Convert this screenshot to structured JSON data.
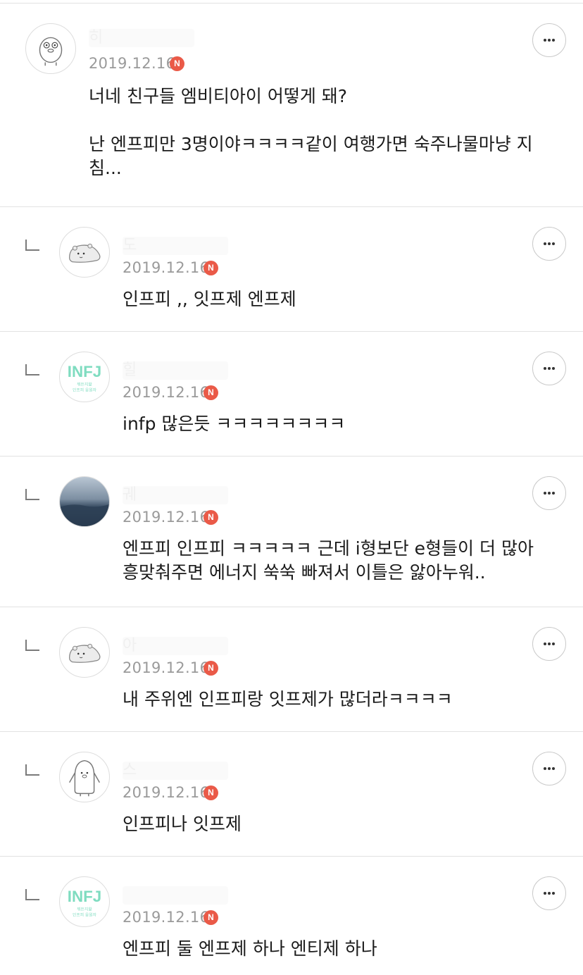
{
  "comments": [
    {
      "nickname": "히",
      "date": "2019.12.16",
      "badge": "N",
      "avatar": "duck",
      "text": "너네 친구들 엠비티아이 어떻게 돼?\n\n난 엔프피만 3명이야ㅋㅋㅋㅋ같이 여행가면 숙주나물마냥 지\n침...",
      "is_reply": false
    },
    {
      "nickname": "도",
      "date": "2019.12.16",
      "badge": "N",
      "avatar": "seal",
      "text": "인프피 ,, 잇프제 엔프제",
      "is_reply": true
    },
    {
      "nickname": "힐",
      "date": "2019.12.16",
      "badge": "N",
      "avatar": "infj",
      "avatar_text": "INFJ",
      "avatar_sub1": "뭐든지할",
      "avatar_sub2": "인프피 응원자",
      "text": "infp 많은듯 ㅋㅋㅋㅋㅋㅋㅋㅋ",
      "is_reply": true
    },
    {
      "nickname": "궤",
      "date": "2019.12.16",
      "badge": "N",
      "avatar": "sky",
      "text": "엔프피 인프피 ㅋㅋㅋㅋㅋ 근데 i형보단 e형들이 더 많아\n흥맞춰주면 에너지 쑥쑥 빠져서 이틀은 앓아누워..",
      "is_reply": true
    },
    {
      "nickname": "아",
      "date": "2019.12.16",
      "badge": "N",
      "avatar": "seal",
      "text": "내 주위엔 인프피랑 잇프제가 많더라ㅋㅋㅋㅋ",
      "is_reply": true
    },
    {
      "nickname": "스",
      "date": "2019.12.16",
      "badge": "N",
      "avatar": "penguin",
      "text": "인프피나 잇프제",
      "is_reply": true
    },
    {
      "nickname": "",
      "date": "2019.12.16",
      "badge": "N",
      "avatar": "infj",
      "avatar_text": "INFJ",
      "avatar_sub1": "뭐든지할",
      "avatar_sub2": "인프피 응원자",
      "text": "엔프피 둘 엔프제 하나 엔티제 하나",
      "is_reply": true
    }
  ],
  "colors": {
    "badge": "#ea5a48",
    "divider": "#e2e2e2",
    "date": "#9a9a9a",
    "infj": "#7fdcc0"
  }
}
